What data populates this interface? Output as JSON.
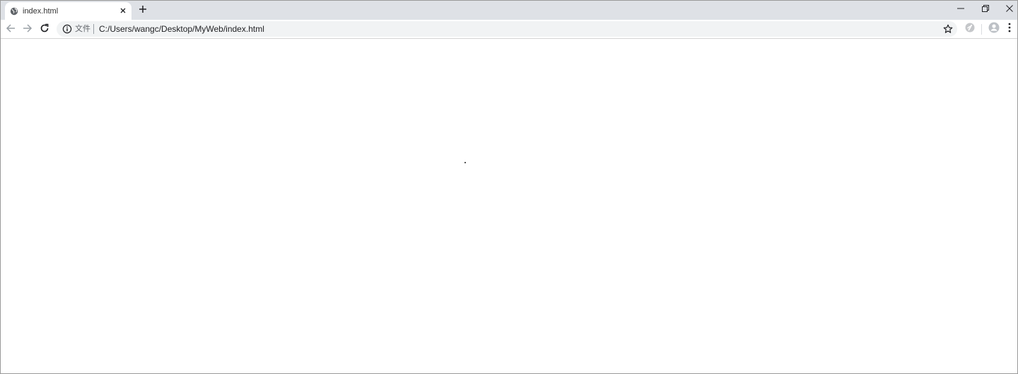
{
  "tab": {
    "title": "index.html",
    "favicon": "globe-icon",
    "close_icon": "close-icon"
  },
  "new_tab_icon": "plus-icon",
  "window_controls": {
    "minimize_icon": "minimize-icon",
    "restore_icon": "restore-icon",
    "close_icon": "close-icon"
  },
  "toolbar": {
    "back_icon": "arrow-left-icon",
    "forward_icon": "arrow-right-icon",
    "reload_icon": "reload-icon",
    "omnibox": {
      "info_icon": "info-icon",
      "scheme_label": "文件",
      "url": "C:/Users/wangc/Desktop/MyWeb/index.html",
      "bookmark_icon": "star-icon"
    },
    "extension_icon": "extension-icon",
    "profile_icon": "avatar-icon",
    "menu_icon": "more-vert-icon"
  },
  "colors": {
    "tabstrip_bg": "#dee1e6",
    "omnibox_bg": "#f1f3f4",
    "icon": "#5f6368",
    "text": "#202124"
  }
}
